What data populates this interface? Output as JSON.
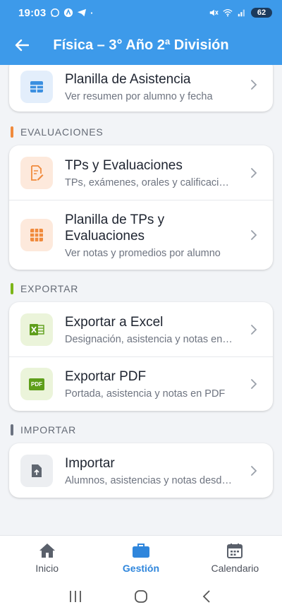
{
  "status_bar": {
    "time": "19:03",
    "battery": "62"
  },
  "appbar": {
    "title": "Física – 3° Año 2ª División"
  },
  "sections": {
    "evaluaciones": {
      "label": "EVALUACIONES",
      "color": "#f08a3c"
    },
    "exportar": {
      "label": "EXPORTAR",
      "color": "#7cb518"
    },
    "importar": {
      "label": "IMPORTAR",
      "color": "#6b7280"
    }
  },
  "items": {
    "asistencia": {
      "title": "Planilla de Asistencia",
      "subtitle": "Ver resumen por alumno y fecha",
      "icon": "table-icon"
    },
    "tps": {
      "title": "TPs y Evaluaciones",
      "subtitle": "TPs, exámenes, orales y calificaciones",
      "icon": "edit-document-icon"
    },
    "planilla_tps": {
      "title": "Planilla de TPs y Evaluaciones",
      "subtitle": "Ver notas y promedios por alumno",
      "icon": "grid-icon"
    },
    "excel": {
      "title": "Exportar a Excel",
      "subtitle": "Designación, asistencia y notas en Excel",
      "icon": "excel-icon"
    },
    "pdf": {
      "title": "Exportar PDF",
      "subtitle": "Portada, asistencia y notas en PDF",
      "icon": "pdf-icon",
      "badge": "PDF"
    },
    "importar": {
      "title": "Importar",
      "subtitle": "Alumnos, asistencias y notas desde archivo",
      "icon": "upload-file-icon"
    }
  },
  "bottom_nav": [
    {
      "label": "Inicio",
      "icon": "home-icon"
    },
    {
      "label": "Gestión",
      "icon": "briefcase-icon",
      "active": true
    },
    {
      "label": "Calendario",
      "icon": "calendar-icon"
    }
  ],
  "colors": {
    "primary": "#3d9aea",
    "active_nav": "#2f86dc"
  }
}
